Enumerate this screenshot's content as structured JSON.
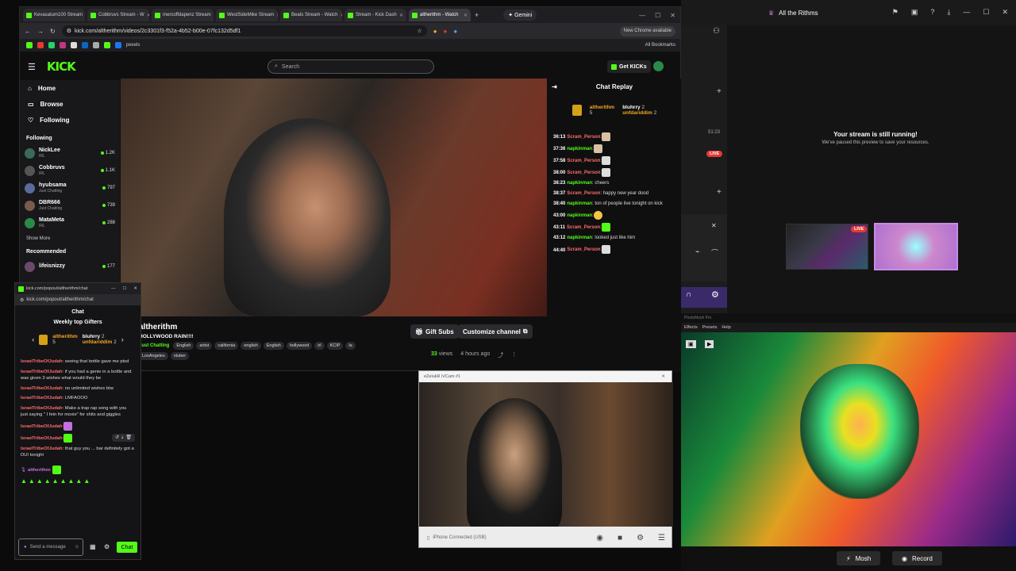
{
  "browser": {
    "tabs": [
      {
        "label": "Kevasatum100 Stream"
      },
      {
        "label": "Cobbruvs Stream - W"
      },
      {
        "label": "mercoffdapenz Stream"
      },
      {
        "label": "WestSideMike Stream"
      },
      {
        "label": "Beats Stream - Watch"
      },
      {
        "label": "Stream - Kick Dash"
      },
      {
        "label": "altherithm - Watch"
      }
    ],
    "gemini_label": "✦ Gemini",
    "url": "kick.com/altherithm/videos/2c3301f3-f52a-4b52-b00e-07fc132d5df1",
    "new_chrome_label": "New Chrome available",
    "bookmarks_right": "All Bookmarks",
    "bookmark_pexels": "pexels"
  },
  "kick": {
    "logo": "KICK",
    "search_placeholder": "Search",
    "get_kicks": "Get KICKs",
    "nav": [
      {
        "label": "Home",
        "icon": "home-icon"
      },
      {
        "label": "Browse",
        "icon": "browse-icon"
      },
      {
        "label": "Following",
        "icon": "heart-icon"
      }
    ],
    "following_header": "Following",
    "following": [
      {
        "name": "NickLee",
        "category": "IRL",
        "viewers": "1.2K"
      },
      {
        "name": "Cobbruvs",
        "category": "IRL",
        "viewers": "1.1K"
      },
      {
        "name": "hyubsama",
        "category": "Just Chatting",
        "viewers": "797"
      },
      {
        "name": "DBR666",
        "category": "Just Chatting",
        "viewers": "739"
      },
      {
        "name": "MataMeta",
        "category": "IRL",
        "viewers": "288"
      }
    ],
    "show_more": "Show More",
    "recommended_header": "Recommended",
    "recommended": [
      {
        "name": "lifeisnizzy",
        "viewers": "177"
      }
    ]
  },
  "chat_replay": {
    "title": "Chat Replay",
    "gifters": [
      {
        "name": "altherithm",
        "count": "5"
      },
      {
        "name": "bluhrry",
        "count": "2"
      },
      {
        "name": "unfdariddim",
        "count": "2"
      }
    ],
    "messages": [
      {
        "time": "36:13",
        "user": "Scram_Person",
        "text": ":",
        "emote": true
      },
      {
        "time": "37:36",
        "user": "napkinman",
        "text": ":",
        "emote": true
      },
      {
        "time": "37:58",
        "user": "Scram_Person",
        "text": ":",
        "emote": true
      },
      {
        "time": "38:00",
        "user": "Scram_Person",
        "text": ":",
        "emote": true
      },
      {
        "time": "38:23",
        "user": "napkinman",
        "text": ": cheers",
        "emote": false
      },
      {
        "time": "38:37",
        "user": "Scram_Person",
        "text": ": happy new year dood",
        "emote": false
      },
      {
        "time": "38:40",
        "user": "napkinman",
        "text": ": ton of people live tonight on kick",
        "emote": false
      },
      {
        "time": "43:00",
        "user": "napkinman",
        "text": ":",
        "emote": true
      },
      {
        "time": "43:11",
        "user": "Scram_Person",
        "text": ":",
        "emote": true
      },
      {
        "time": "43:12",
        "user": "napkinman",
        "text": ": looked just like him",
        "emote": false
      },
      {
        "time": "44:40",
        "user": "Scram_Person",
        "text": ":",
        "emote": true
      }
    ]
  },
  "stream": {
    "channel": "altherithm",
    "title": "HOLLYWOOD RAIN!!!!",
    "category": "Just Chatting",
    "tags": [
      "English",
      "artist",
      "california",
      "english",
      "English",
      "hollywood",
      "irl",
      "KCIP",
      "la",
      "LosAngeles",
      "vtuber"
    ],
    "gift_subs": "Gift Subs",
    "customize": "Customize channel",
    "views": "33",
    "views_label": "views",
    "ago": "4 hours ago"
  },
  "popout": {
    "window_title": "kick.com/popout/altherithm/chat",
    "url": "kick.com/popout/altherithm/chat",
    "chat_title": "Chat",
    "weekly_gifters_title": "Weekly top Gifters",
    "gifters": [
      {
        "name": "altherithm",
        "count": "5"
      },
      {
        "name": "bluhrry",
        "count": "2"
      },
      {
        "name": "unfdariddim",
        "count": "2"
      }
    ],
    "messages": [
      {
        "user": "IsraelTribeOfJudah",
        "text": ": seeing that bottle gave me ptsd"
      },
      {
        "user": "IsraelTribeOfJudah",
        "text": ": if you had a genie in a bottle and was given 3 wishes what would they be"
      },
      {
        "user": "IsraelTribeOfJudah",
        "text": ": no unlimited wishes btw"
      },
      {
        "user": "IsraelTribeOfJudah",
        "text": ": LMFAOOO"
      },
      {
        "user": "IsraelTribeOfJudah",
        "text": ": Make a trap rap song with you just saying \" I fein for moxie\" for shits and giggles"
      },
      {
        "user": "IsraelTribeOfJudah",
        "text": ":"
      },
      {
        "user": "IsraelTribeOfJudah",
        "text": ":"
      },
      {
        "user": "IsraelTribeOfJudah",
        "text": ": that guy you ... bar definitely got a DUI tonight"
      }
    ],
    "self_user": "altherithm",
    "input_placeholder": "Send a message",
    "chat_button": "Chat"
  },
  "webcam": {
    "window_title": "eZelukR iVCam #1",
    "status": "iPhone Connected (USB)"
  },
  "right_app": {
    "title": "All the Rithms",
    "time": "51:23",
    "live_label": "LIVE",
    "still_running": "Your stream is still running!",
    "paused_msg": "We've paused this preview to save your resources."
  },
  "mosh": {
    "title": "PhotoMosh Pro",
    "menu": [
      "Effects",
      "Presets",
      "Help"
    ],
    "mosh_button": "Mosh",
    "record_button": "Record"
  },
  "colors": {
    "kick_green": "#53fc18",
    "user_red": "#ff6b6b",
    "live_red": "#e53935"
  }
}
